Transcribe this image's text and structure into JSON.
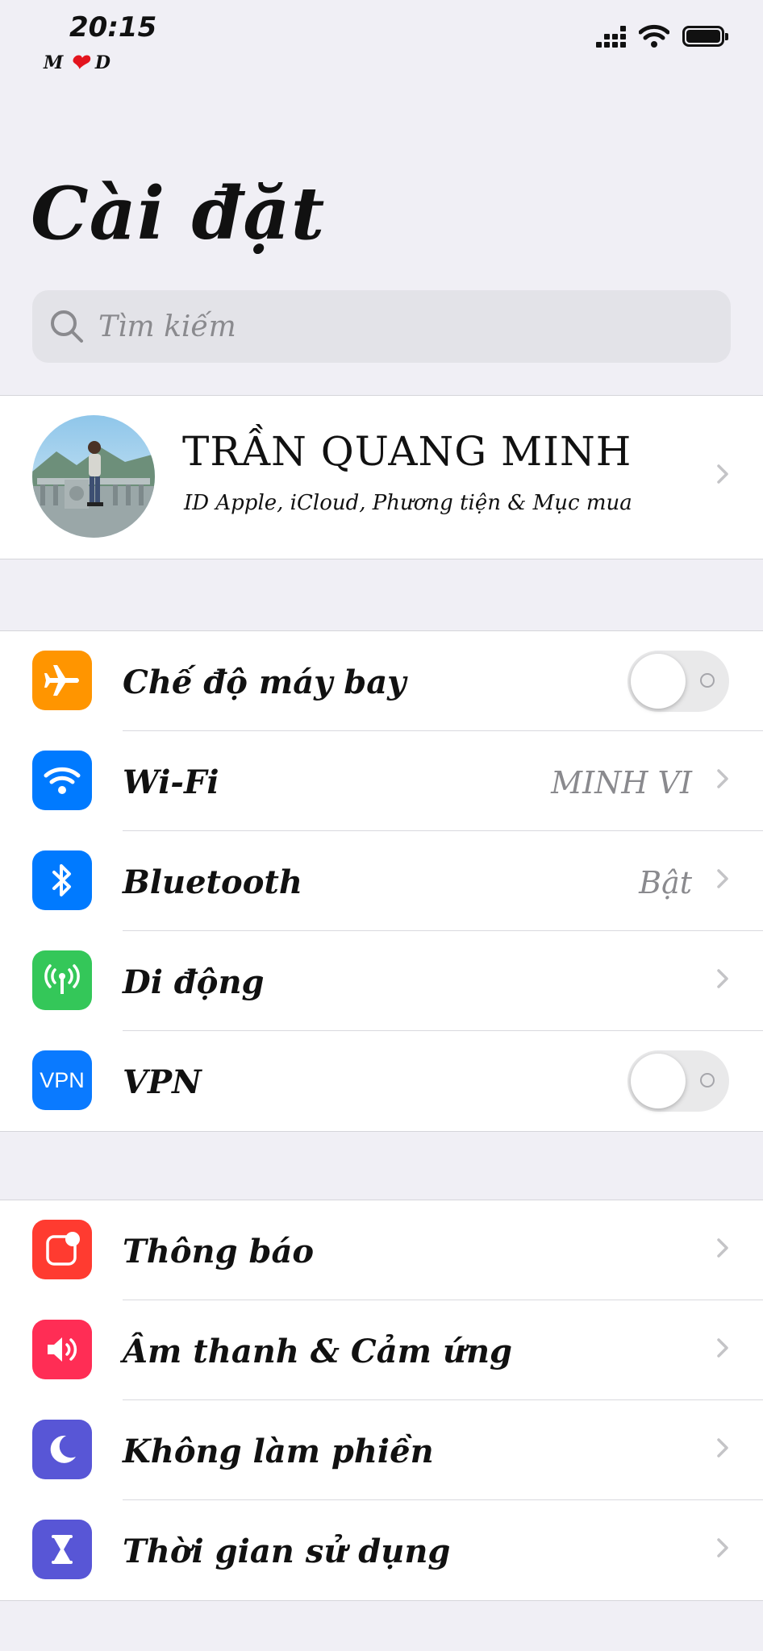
{
  "status_bar": {
    "time": "20:15",
    "carrier_left": "M",
    "carrier_right": "D",
    "carrier_heart": "❤"
  },
  "page_title": "Cài đặt",
  "search": {
    "placeholder": "Tìm kiếm"
  },
  "profile": {
    "name": "TRẦN QUANG MINH",
    "subtitle": "ID Apple, iCloud, Phương tiện & Mục mua"
  },
  "connectivity": [
    {
      "label": "Chế độ máy bay",
      "icon": "airplane-icon",
      "icon_color": "#ff9500",
      "toggle_on": false
    },
    {
      "label": "Wi-Fi",
      "icon": "wifi-icon",
      "icon_color": "#007aff",
      "value": "MINH VI"
    },
    {
      "label": "Bluetooth",
      "icon": "bluetooth-icon",
      "icon_color": "#007aff",
      "value": "Bật"
    },
    {
      "label": "Di động",
      "icon": "cellular-icon",
      "icon_color": "#34c759"
    },
    {
      "label": "VPN",
      "icon": "vpn-icon",
      "icon_color": "#0a7aff",
      "icon_text": "VPN",
      "toggle_on": false
    }
  ],
  "notifications": [
    {
      "label": "Thông báo",
      "icon": "notifications-icon",
      "icon_color": "#ff3b30"
    },
    {
      "label": "Âm thanh & Cảm ứng",
      "icon": "sound-icon",
      "icon_color": "#ff2d55"
    },
    {
      "label": "Không làm phiền",
      "icon": "moon-icon",
      "icon_color": "#5856d6"
    },
    {
      "label": "Thời gian sử dụng",
      "icon": "hourglass-icon",
      "icon_color": "#5856d6"
    }
  ]
}
